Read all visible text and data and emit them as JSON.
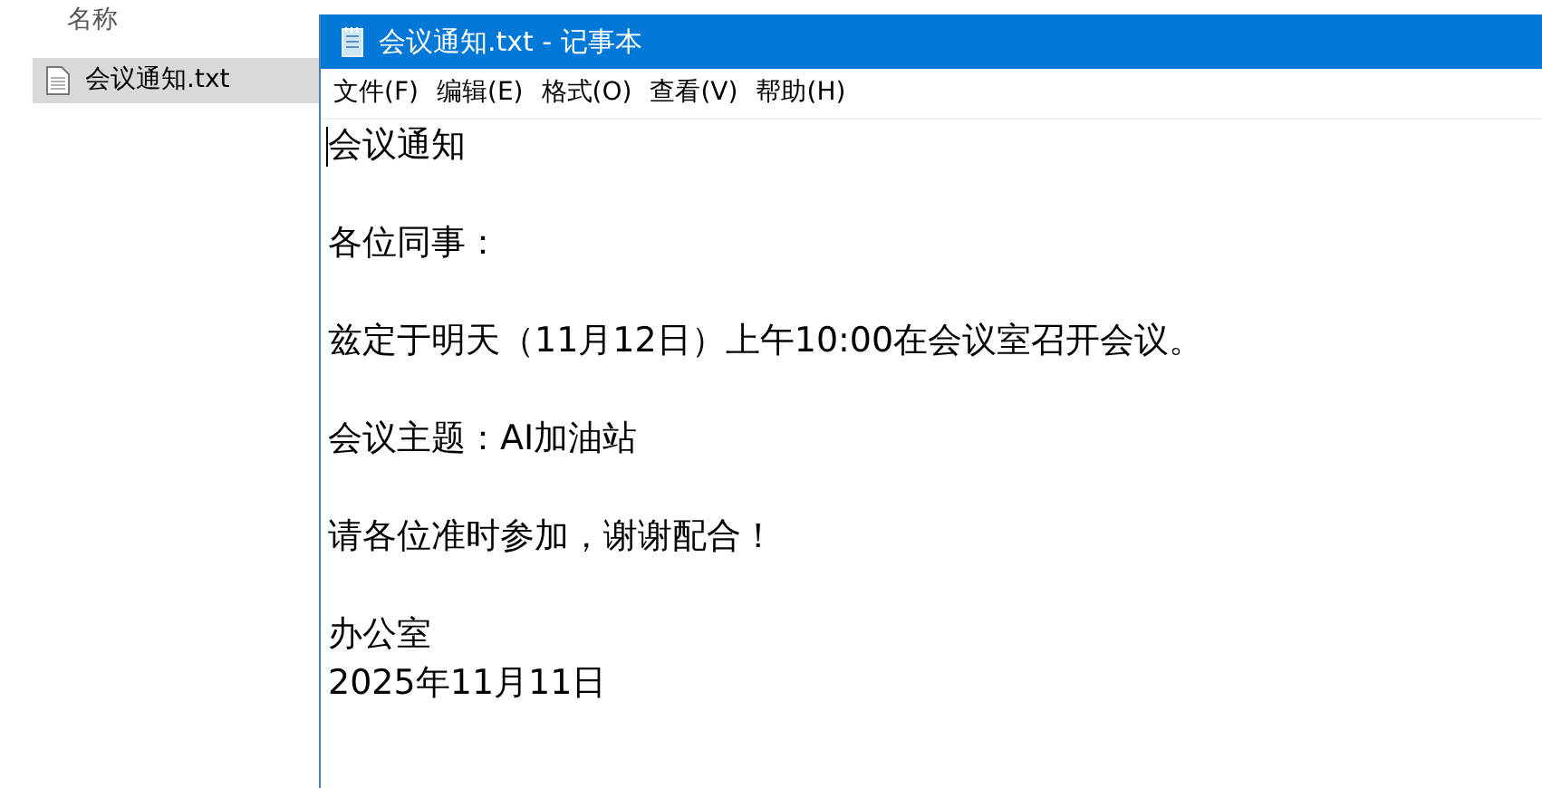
{
  "explorer": {
    "column_header": "名称",
    "files": [
      {
        "name": "会议通知.txt",
        "selected": true
      }
    ]
  },
  "notepad": {
    "title": "会议通知.txt - 记事本",
    "menu": [
      "文件(F)",
      "编辑(E)",
      "格式(O)",
      "查看(V)",
      "帮助(H)"
    ],
    "paragraphs": [
      [
        "会议通知"
      ],
      [
        "各位同事："
      ],
      [
        "兹定于明天（11月12日）上午10:00在会议室召开会议。"
      ],
      [
        "会议主题：AI加油站"
      ],
      [
        "请各位准时参加，谢谢配合！"
      ],
      [
        "办公室",
        "2025年11月11日"
      ]
    ]
  }
}
